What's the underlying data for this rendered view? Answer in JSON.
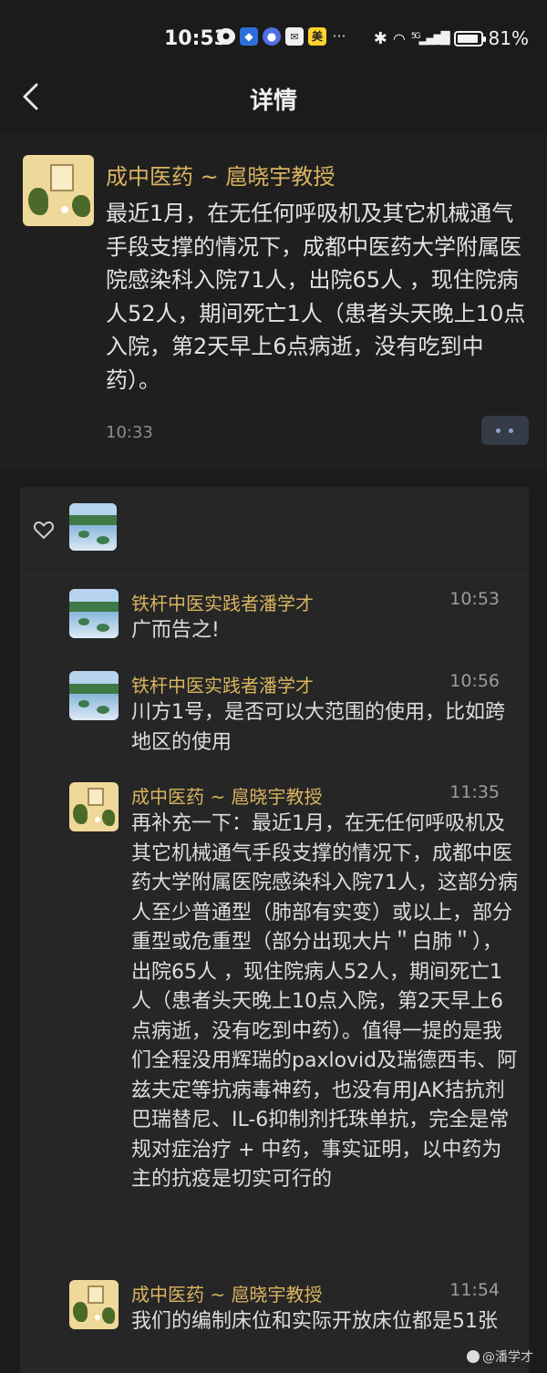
{
  "status_bar": {
    "time": "10:53",
    "icons": [
      "chat-bubble-icon",
      "blue-app-icon",
      "shield-app-icon",
      "mail-icon",
      "meituan-icon",
      "more-notifications-icon"
    ],
    "meituan_glyph": "美",
    "more_glyph": "···",
    "signal_label": "5G",
    "battery": "81%",
    "battery_level": 0.81
  },
  "nav": {
    "title": "详情"
  },
  "post": {
    "author": "成中医药 ~ 扈晓宇教授",
    "body": "最近1月，在无任何呼吸机及其它机械通气手段支撑的情况下，成都中医药大学附属医院感染科入院71人，出院65人 ，现住院病人52人，期间死亡1人（患者头天晚上10点入院，第2天早上6点病逝，没有吃到中药）。",
    "time": "10:33"
  },
  "comments": [
    {
      "author": "铁杆中医实践者潘学才",
      "time": "10:53",
      "text": "广而告之!",
      "avatar": "landscape"
    },
    {
      "author": "铁杆中医实践者潘学才",
      "time": "10:56",
      "text": "川方1号，是否可以大范围的使用，比如跨地区的使用",
      "avatar": "landscape"
    },
    {
      "author": "成中医药 ~ 扈晓宇教授",
      "time": "11:35",
      "text": "再补充一下：最近1月，在无任何呼吸机及其它机械通气手段支撑的情况下，成都中医药大学附属医院感染科入院71人，这部分病人至少普通型（肺部有实变）或以上，部分重型或危重型（部分出现大片＂白肺＂），出院65人 ，现住院病人52人，期间死亡1人（患者头天晚上10点入院，第2天早上6点病逝，没有吃到中药）。值得一提的是我们全程没用辉瑞的paxlovid及瑞德西韦、阿兹夫定等抗病毒神药，也没有用JAK拮抗剂巴瑞替尼、IL-6抑制剂托珠单抗，完全是常规对症治疗 + 中药，事实证明，以中药为主的抗疫是切实可行的",
      "avatar": "yellow"
    },
    {
      "author": "成中医药 ~ 扈晓宇教授",
      "time": "11:54",
      "text": "我们的编制床位和实际开放床位都是51张",
      "avatar": "yellow"
    }
  ],
  "watermark": "@潘学才"
}
